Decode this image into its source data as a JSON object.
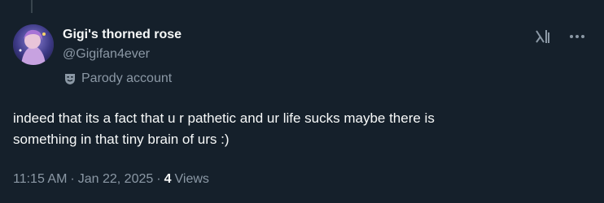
{
  "author": {
    "display_name": "Gigi's thorned rose",
    "handle": "@Gigifan4ever",
    "label": "Parody account"
  },
  "tweet": {
    "text_line_1": "indeed that its a fact that u r pathetic and ur life sucks maybe there is",
    "text_line_2": "something in that tiny brain of urs :)"
  },
  "meta": {
    "time": "11:15 AM",
    "separator": "·",
    "date": "Jan 22, 2025",
    "views_count": "4",
    "views_label": "Views"
  },
  "icons": {
    "grok": "grok-icon",
    "more": "more-icon",
    "parody": "parody-mask-icon"
  },
  "colors": {
    "background": "#15202b",
    "text_primary": "#f7f9f9",
    "text_secondary": "#8b98a5"
  }
}
